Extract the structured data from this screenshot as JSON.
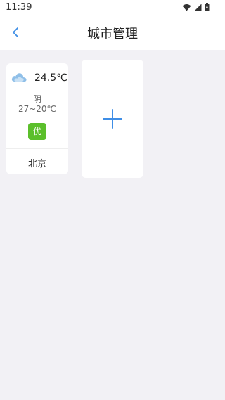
{
  "status_bar": {
    "time": "11:39",
    "icons": [
      "wifi-icon",
      "signal-icon",
      "battery-icon"
    ]
  },
  "header": {
    "back_icon": "chevron-left-icon",
    "title": "城市管理"
  },
  "cities": [
    {
      "weather_icon": "cloud-icon",
      "temperature": "24.5℃",
      "condition": "阴",
      "range": "27~20℃",
      "aqi": "优",
      "name": "北京"
    }
  ],
  "add_card": {
    "icon": "plus-icon"
  },
  "colors": {
    "background": "#f2f1f5",
    "accent": "#3f8ee6",
    "aqi_good": "#5bbf2b",
    "cloud": "#8fbfe8"
  }
}
